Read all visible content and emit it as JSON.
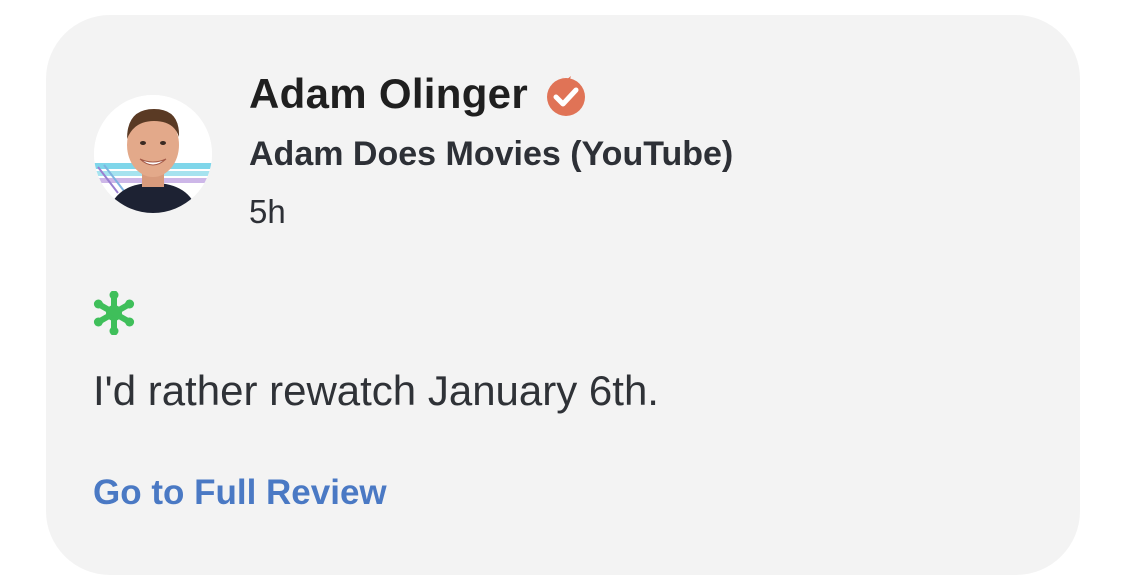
{
  "review": {
    "critic_name": "Adam Olinger",
    "publication": "Adam Does Movies (YouTube)",
    "time_ago": "5h",
    "quote": "I'd rather rewatch January 6th.",
    "link_label": "Go to Full Review",
    "score_icon": "rotten-splat-icon",
    "verified_icon": "verified-tomato-badge-icon",
    "colors": {
      "verified_badge": "#e07356",
      "score_icon": "#3fbf5a",
      "link": "#4a79c4",
      "card_background": "#f3f3f3"
    }
  }
}
